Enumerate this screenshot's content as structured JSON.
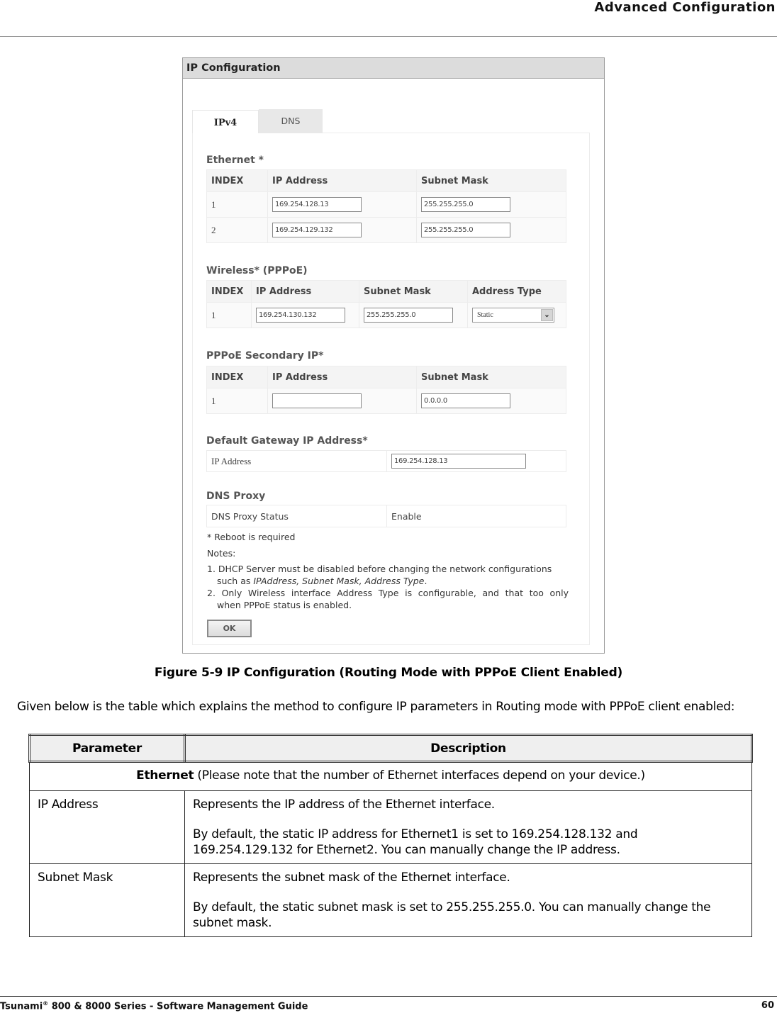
{
  "header": {
    "section_title": "Advanced Configuration"
  },
  "screenshot": {
    "panel_title": "IP Configuration",
    "tabs": [
      {
        "label": "IPv4",
        "active": true
      },
      {
        "label": "DNS",
        "active": false
      }
    ],
    "ethernet": {
      "title": "Ethernet *",
      "columns": [
        "INDEX",
        "IP Address",
        "Subnet Mask"
      ],
      "rows": [
        {
          "index": "1",
          "ip": "169.254.128.13",
          "mask": "255.255.255.0"
        },
        {
          "index": "2",
          "ip": "169.254.129.132",
          "mask": "255.255.255.0"
        }
      ]
    },
    "wireless": {
      "title": "Wireless* (PPPoE)",
      "columns": [
        "INDEX",
        "IP Address",
        "Subnet Mask",
        "Address Type"
      ],
      "rows": [
        {
          "index": "1",
          "ip": "169.254.130.132",
          "mask": "255.255.255.0",
          "address_type": "Static"
        }
      ]
    },
    "pppoe_secondary": {
      "title": "PPPoE Secondary IP*",
      "columns": [
        "INDEX",
        "IP Address",
        "Subnet Mask"
      ],
      "rows": [
        {
          "index": "1",
          "ip": "",
          "mask": "0.0.0.0"
        }
      ]
    },
    "default_gateway": {
      "title": "Default Gateway IP Address*",
      "label": "IP Address",
      "value": "169.254.128.13"
    },
    "dns_proxy": {
      "title": "DNS Proxy",
      "label": "DNS Proxy Status",
      "value": "Enable"
    },
    "reboot_note": "* Reboot is required",
    "notes_label": "Notes:",
    "note1_prefix": "1. DHCP Server must be disabled before changing the network configurations",
    "note1_line2_prefix": "such as ",
    "note1_italic": "IPAddress, Subnet Mask, Address Type",
    "note1_suffix": ".",
    "note2_line1": "2. Only Wireless interface Address Type is configurable, and that too only",
    "note2_line2": "when PPPoE status is enabled.",
    "ok_label": "OK"
  },
  "caption": "Figure 5-9 IP Configuration (Routing Mode with PPPoE Client Enabled)",
  "intro": "Given below is the table which explains the method to configure IP parameters in Routing mode with PPPoE client enabled:",
  "doc_table": {
    "headers": [
      "Parameter",
      "Description"
    ],
    "group_bold": "Ethernet",
    "group_rest": " (Please note that the number of Ethernet interfaces depend on your device.)",
    "rows": [
      {
        "param": "IP Address",
        "desc1": "Represents the IP address of the Ethernet interface.",
        "desc2": "By default, the static IP address for Ethernet1 is set to 169.254.128.132 and 169.254.129.132 for Ethernet2. You can manually change the IP address."
      },
      {
        "param": "Subnet Mask",
        "desc1": "Represents the subnet mask of the Ethernet interface.",
        "desc2": "By default, the static subnet mask is set to 255.255.255.0. You can manually change the subnet mask."
      }
    ]
  },
  "footer": {
    "product": "Tsunami",
    "registered": "®",
    "guide": " 800 & 8000 Series - Software Management Guide",
    "page_number": "60"
  }
}
